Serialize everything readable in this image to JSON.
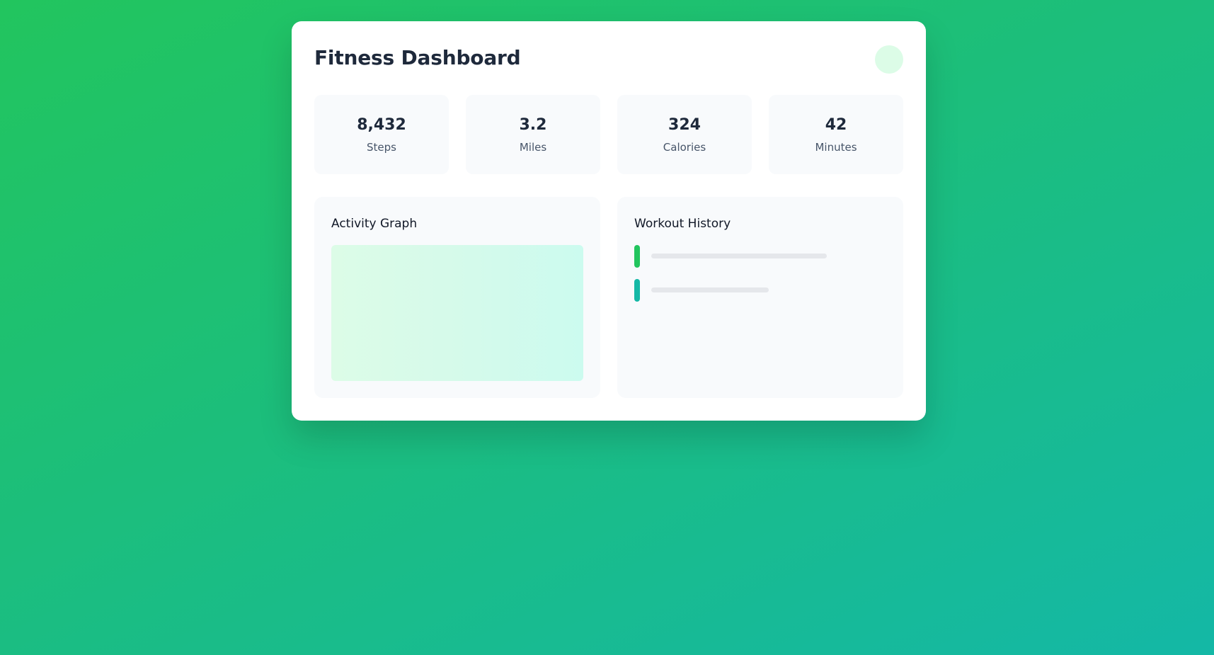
{
  "header": {
    "title": "Fitness Dashboard"
  },
  "stats": [
    {
      "value": "8,432",
      "label": "Steps"
    },
    {
      "value": "3.2",
      "label": "Miles"
    },
    {
      "value": "324",
      "label": "Calories"
    },
    {
      "value": "42",
      "label": "Minutes"
    }
  ],
  "activity": {
    "title": "Activity Graph"
  },
  "workouts": {
    "title": "Workout History",
    "items": [
      {
        "color": "#22c55e"
      },
      {
        "color": "#14b8a6"
      }
    ]
  },
  "colors": {
    "gradient_start": "#22c55e",
    "gradient_end": "#14b8a6",
    "avatar_bg": "#dcfce7"
  }
}
